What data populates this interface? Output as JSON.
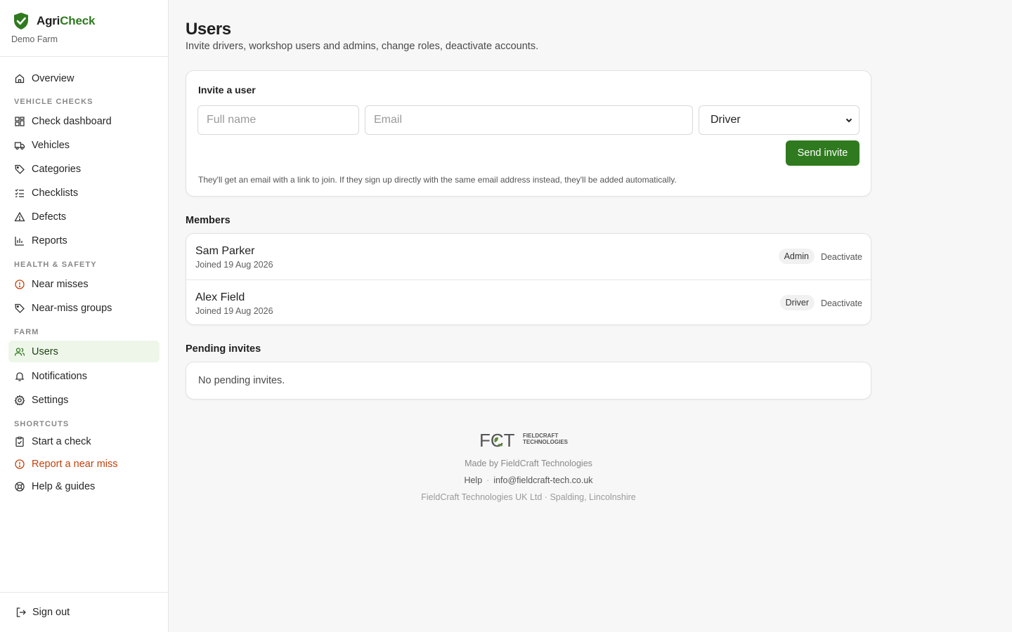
{
  "brand": {
    "name_part1": "Agri",
    "name_part2": "Check",
    "farm": "Demo Farm"
  },
  "sidebar": {
    "overview": "Overview",
    "sections": {
      "vehicle_checks": "VEHICLE CHECKS",
      "health_safety": "HEALTH & SAFETY",
      "farm": "FARM",
      "shortcuts": "SHORTCUTS"
    },
    "vehicle_items": [
      "Check dashboard",
      "Vehicles",
      "Categories",
      "Checklists",
      "Defects",
      "Reports"
    ],
    "hs_items": [
      "Near misses",
      "Near-miss groups"
    ],
    "farm_items": [
      "Users",
      "Notifications",
      "Settings"
    ],
    "shortcut_items": [
      "Start a check",
      "Report a near miss",
      "Help & guides"
    ],
    "sign_out": "Sign out"
  },
  "page": {
    "title": "Users",
    "subtitle": "Invite drivers, workshop users and admins, change roles, deactivate accounts."
  },
  "invite": {
    "title": "Invite a user",
    "name_placeholder": "Full name",
    "email_placeholder": "Email",
    "role_value": "Driver",
    "send_label": "Send invite",
    "hint": "They'll get an email with a link to join. If they sign up directly with the same email address instead, they'll be added automatically."
  },
  "members": {
    "title": "Members",
    "rows": [
      {
        "name": "Sam Parker",
        "joined": "Joined 19 Aug 2026",
        "role": "Admin",
        "action": "Deactivate"
      },
      {
        "name": "Alex Field",
        "joined": "Joined 19 Aug 2026",
        "role": "Driver",
        "action": "Deactivate"
      }
    ]
  },
  "pending": {
    "title": "Pending invites",
    "empty": "No pending invites."
  },
  "footer": {
    "logo_text": "FCT",
    "logo_sub1": "FIELDCRAFT",
    "logo_sub2": "TECHNOLOGIES",
    "made_by": "Made by FieldCraft Technologies",
    "help": "Help",
    "sep": "·",
    "email": "info@fieldcraft-tech.co.uk",
    "company": "FieldCraft Technologies UK Ltd · Spalding, Lincolnshire"
  },
  "colors": {
    "accent": "#2f7a1f",
    "warn": "#c2410c",
    "active_bg": "#eef6ea"
  },
  "icons": {
    "overview": "home-icon",
    "check_dashboard": "grid-icon",
    "vehicles": "truck-icon",
    "categories": "tag-icon",
    "checklists": "list-check-icon",
    "defects": "warning-triangle-icon",
    "reports": "bar-chart-icon",
    "near_misses": "alert-circle-icon",
    "near_miss_groups": "tag-icon",
    "users": "users-icon",
    "notifications": "bell-icon",
    "settings": "gear-icon",
    "start_check": "clipboard-check-icon",
    "report_near_miss": "alert-circle-icon",
    "help": "lifebuoy-icon",
    "sign_out": "sign-out-icon"
  }
}
